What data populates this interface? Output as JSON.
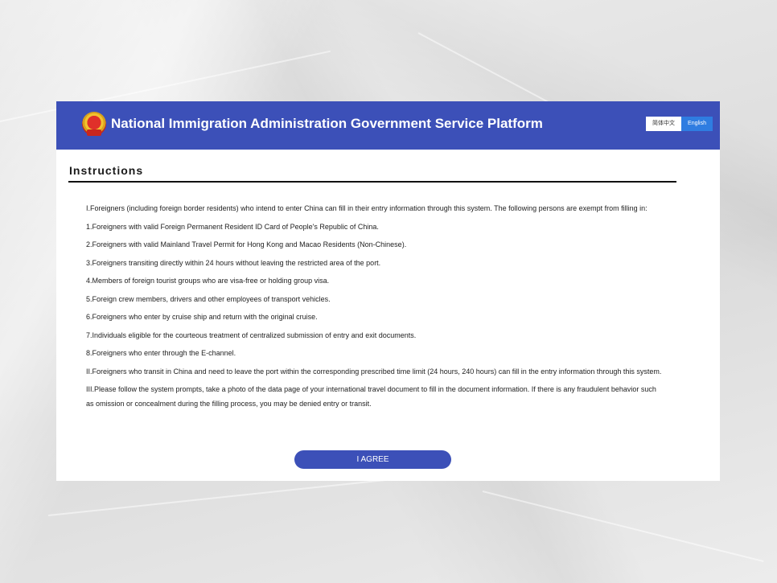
{
  "header": {
    "title": "National Immigration Administration Government Service Platform",
    "lang_chinese": "简体中文",
    "lang_english": "English",
    "emblem_icon": "national-emblem-icon"
  },
  "section": {
    "title": "Instructions"
  },
  "instructions": [
    "I.Foreigners (including foreign border residents) who intend to enter China can fill in their entry information through this system. The following persons are exempt from filling in:",
    "1.Foreigners with valid Foreign Permanent Resident ID Card of People's Republic of China.",
    "2.Foreigners with valid Mainland Travel Permit for Hong Kong and Macao Residents (Non-Chinese).",
    "3.Foreigners transiting directly within 24 hours without leaving the restricted area of the port.",
    "4.Members of foreign tourist groups who are visa-free or holding group visa.",
    "5.Foreign crew members, drivers and other employees of transport vehicles.",
    "6.Foreigners who enter by cruise ship and return with the original cruise.",
    "7.Individuals eligible for the courteous treatment of centralized submission of entry and exit documents.",
    "8.Foreigners who enter through the E-channel.",
    "II.Foreigners who transit in China and need to leave the port within the corresponding prescribed time limit (24 hours, 240 hours) can fill in the entry information through this system.",
    "III.Please follow the system prompts, take a photo of the data page of your international travel document to fill in the document information. If there is any fraudulent behavior such as omission or concealment during the filling process, you may be denied entry or transit."
  ],
  "actions": {
    "agree_label": "I AGREE"
  },
  "colors": {
    "header_bg": "#3c50b8",
    "english_active": "#2f7de1",
    "button_bg": "#3c50b8"
  }
}
